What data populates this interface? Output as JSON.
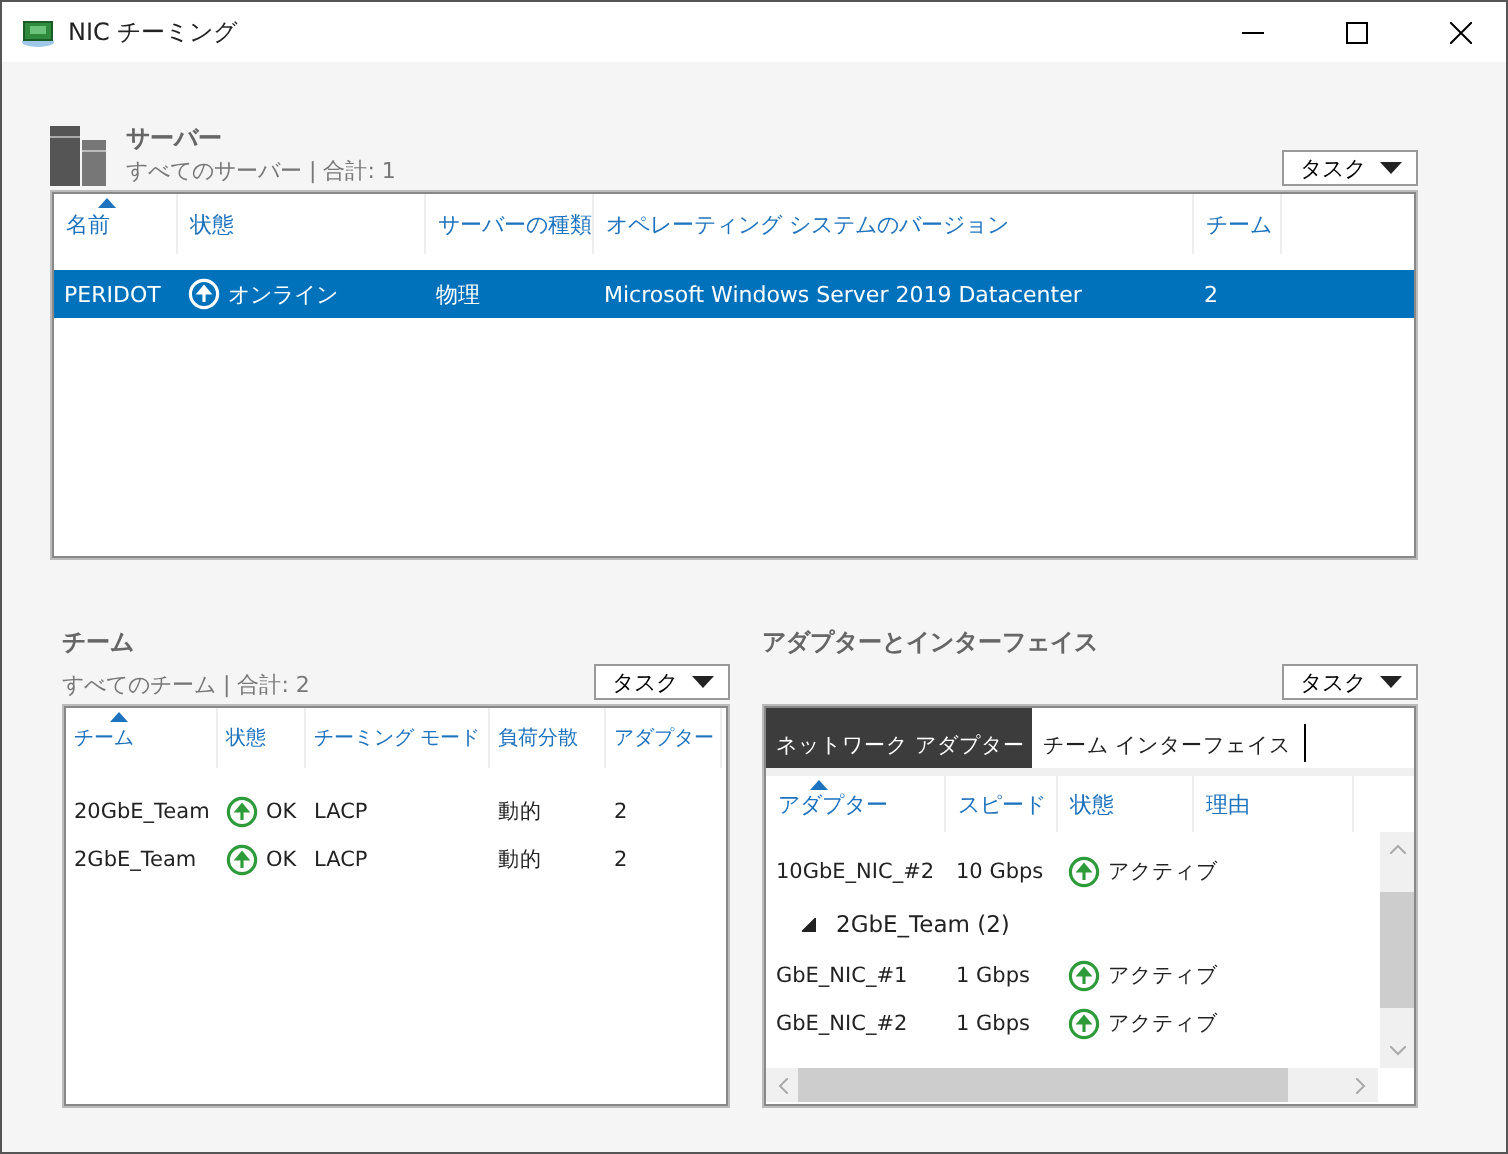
{
  "window": {
    "title": "NIC チーミング"
  },
  "servers": {
    "title": "サーバー",
    "subtitle": "すべてのサーバー | 合計: 1",
    "task_button": "タスク",
    "columns": [
      "名前",
      "状態",
      "サーバーの種類",
      "オペレーティング システムのバージョン",
      "チーム"
    ],
    "rows": [
      {
        "name": "PERIDOT",
        "status": "オンライン",
        "type": "物理",
        "os": "Microsoft Windows Server 2019 Datacenter",
        "teams": "2",
        "selected": true
      }
    ]
  },
  "teams": {
    "title": "チーム",
    "subtitle": "すべてのチーム | 合計: 2",
    "task_button": "タスク",
    "columns": [
      "チーム",
      "状態",
      "チーミング モード",
      "負荷分散",
      "アダプター"
    ],
    "rows": [
      {
        "team": "20GbE_Team",
        "status": "OK",
        "mode": "LACP",
        "balancing": "動的",
        "adapters": "2",
        "selected": false
      },
      {
        "team": "2GbE_Team",
        "status": "OK",
        "mode": "LACP",
        "balancing": "動的",
        "adapters": "2",
        "selected": false
      }
    ]
  },
  "adapters": {
    "title": "アダプターとインターフェイス",
    "task_button": "タスク",
    "tabs": [
      {
        "label": "ネットワーク アダプター",
        "selected": true
      },
      {
        "label": "チーム インターフェイス",
        "selected": false
      }
    ],
    "columns": [
      "アダプター",
      "スピード",
      "状態",
      "理由"
    ],
    "items": [
      {
        "kind": "row",
        "adapter": "10GbE_NIC_#2",
        "speed": "10 Gbps",
        "status": "アクティブ"
      },
      {
        "kind": "group",
        "label": "2GbE_Team (2)",
        "expanded": true
      },
      {
        "kind": "row",
        "adapter": "GbE_NIC_#1",
        "speed": "1 Gbps",
        "status": "アクティブ"
      },
      {
        "kind": "row",
        "adapter": "GbE_NIC_#2",
        "speed": "1 Gbps",
        "status": "アクティブ"
      }
    ]
  }
}
